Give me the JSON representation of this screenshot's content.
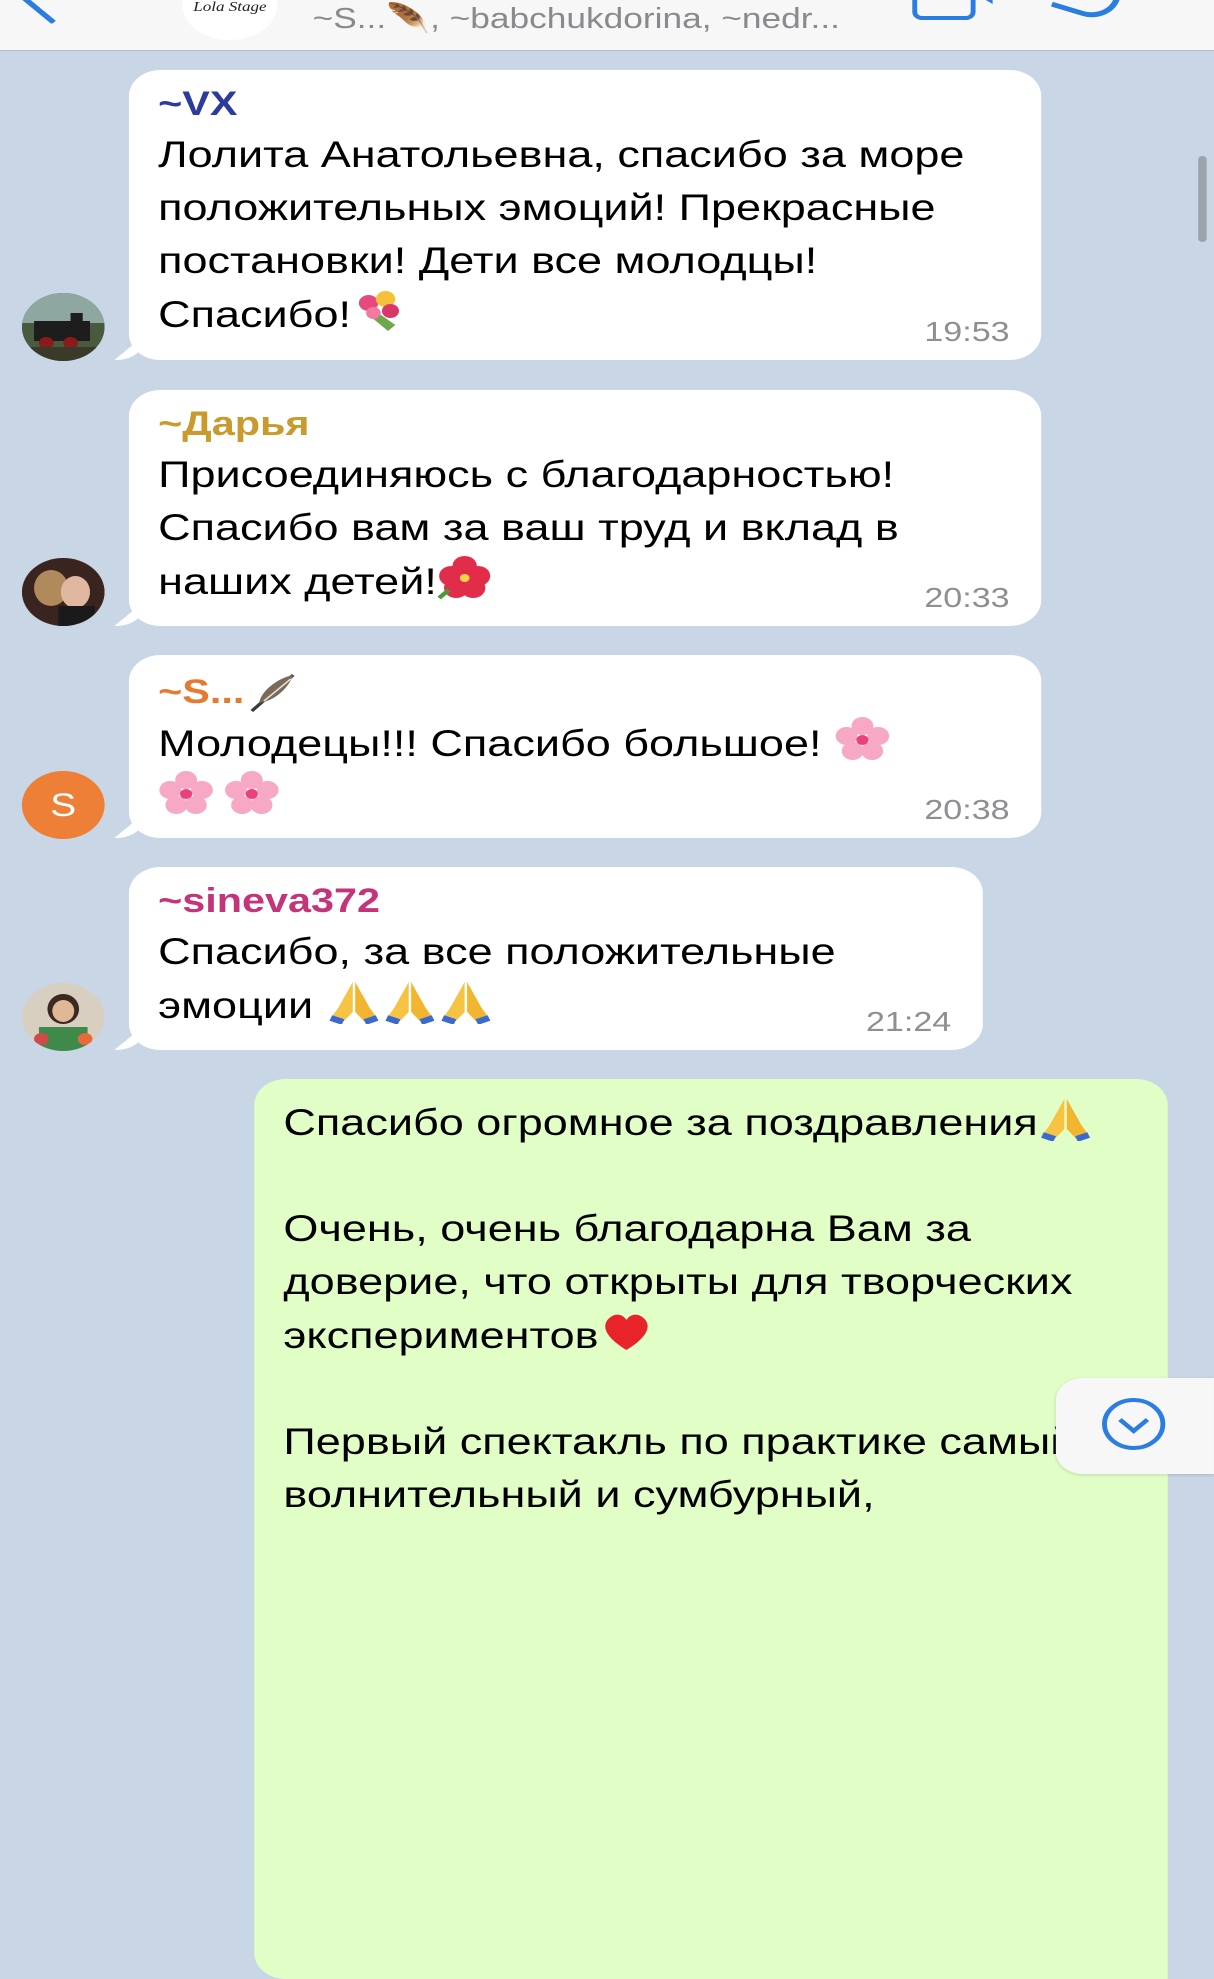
{
  "header": {
    "subtitle": "~S...🪶, ~babchukdorina, ~nedr...",
    "logo_text": "Lola Stage"
  },
  "messages": [
    {
      "sender": "~VX",
      "sender_color": "#2b3b9e",
      "text": "Лолита Анатольевна, спасибо за море положительных эмоций! Прекрасные постановки! Дети все молодцы! Спасибо!",
      "emoji": "bouquet",
      "time": "19:53"
    },
    {
      "sender": "~Дарья",
      "sender_color": "#c99a2e",
      "text": "Присоединяюсь с благодарностью! Спасибо вам за ваш труд и вклад в наших детей!",
      "emoji": "hibiscus",
      "time": "20:33"
    },
    {
      "sender": "~S...",
      "sender_color": "#e57a30",
      "sender_emoji": "feather",
      "text": "Молодецы!!! Спасибо большое!",
      "emoji": "cherry-blossom x3",
      "time": "20:38",
      "avatar_letter": "S",
      "avatar_color": "#ee7f36"
    },
    {
      "sender": "~sineva372",
      "sender_color": "#c4347a",
      "text": "Спасибо, за все положительные эмоции",
      "emoji": "folded-hands x3",
      "time": "21:24"
    }
  ],
  "outgoing": {
    "para1": "Спасибо огромное за поздравления",
    "para2": "Очень, очень благодарна Вам за доверие, что открыты для творческих экспериментов",
    "para3": "Первый спектакль по практике самый волнительный и сумбурный,"
  },
  "colors": {
    "chat_background": "#c8d6e6",
    "incoming_bubble": "#ffffff",
    "outgoing_bubble": "#e1fec6",
    "accent": "#2a7de1",
    "time": "#8e8e93"
  },
  "icons": [
    "back-chevron-icon",
    "video-call-icon",
    "phone-call-icon",
    "scroll-down-icon"
  ]
}
